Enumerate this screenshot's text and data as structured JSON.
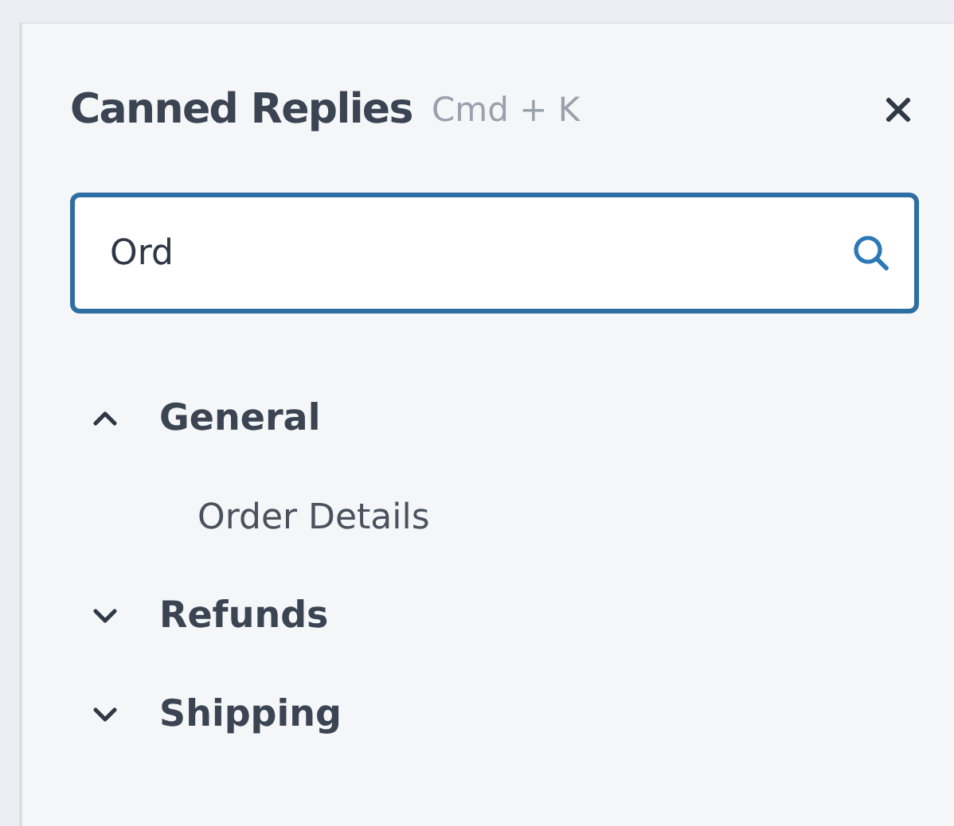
{
  "panel": {
    "title": "Canned Replies",
    "shortcut": "Cmd + K"
  },
  "search": {
    "value": "Ord"
  },
  "groups": [
    {
      "label": "General",
      "expanded": true,
      "children": [
        {
          "label": "Order Details"
        }
      ]
    },
    {
      "label": "Refunds",
      "expanded": false
    },
    {
      "label": "Shipping",
      "expanded": false
    }
  ]
}
